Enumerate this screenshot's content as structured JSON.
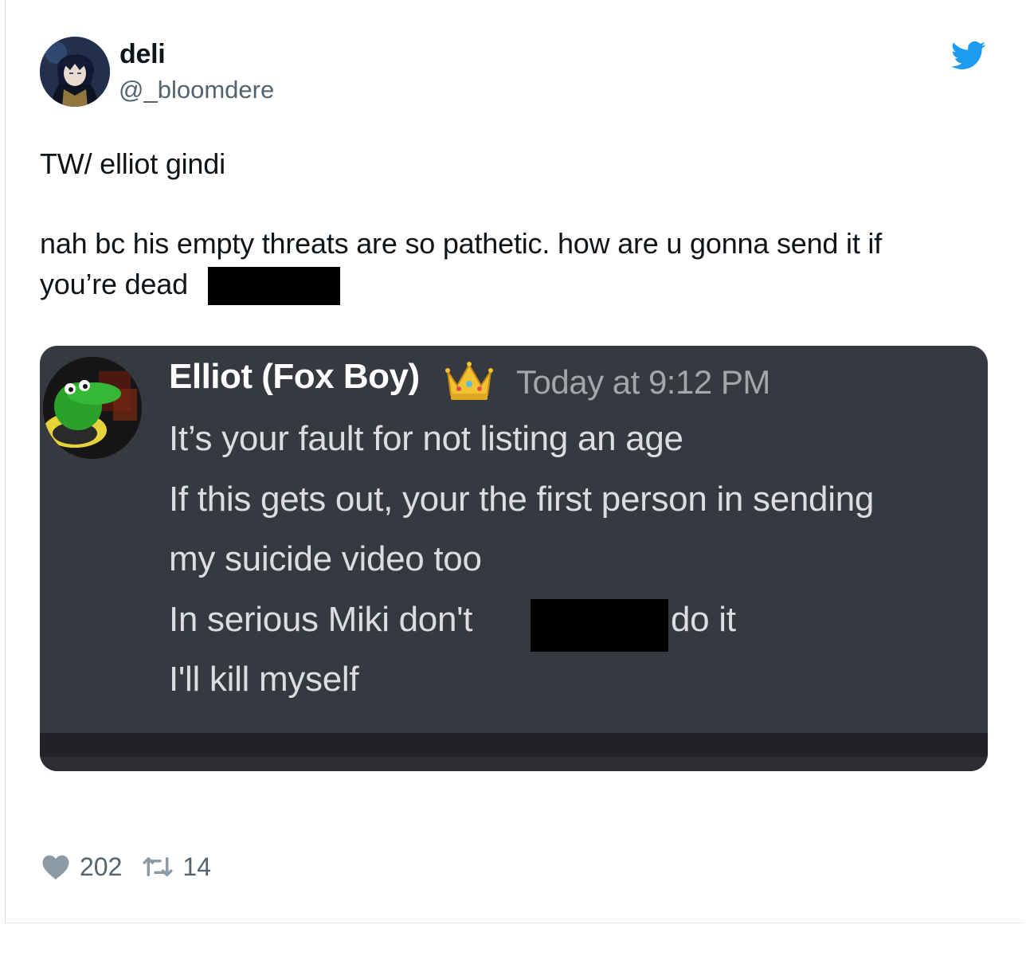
{
  "tweet": {
    "display_name": "deli",
    "handle": "@_bloomdere",
    "text_line_1": "TW/ elliot gindi",
    "text_line_2": "nah bc his empty threats are so pathetic. how are u gonna send it if",
    "text_line_3": "you’re dead",
    "likes": "202",
    "retweets": "14"
  },
  "embed": {
    "author": "Elliot (Fox Boy)",
    "timestamp": "Today at 9:12 PM",
    "lines": [
      "It’s your fault for not listing an age",
      "If this gets out, your the first person in sending",
      "my suicide video too",
      "In serious Miki don't",
      "do it",
      "I'll kill myself"
    ]
  },
  "colors": {
    "twitter_blue": "#1d9bf0",
    "discord_bg": "#36393f",
    "muted_text": "#536471"
  },
  "icons": [
    "twitter-bird-icon",
    "crown-icon",
    "heart-icon",
    "retweet-icon"
  ]
}
